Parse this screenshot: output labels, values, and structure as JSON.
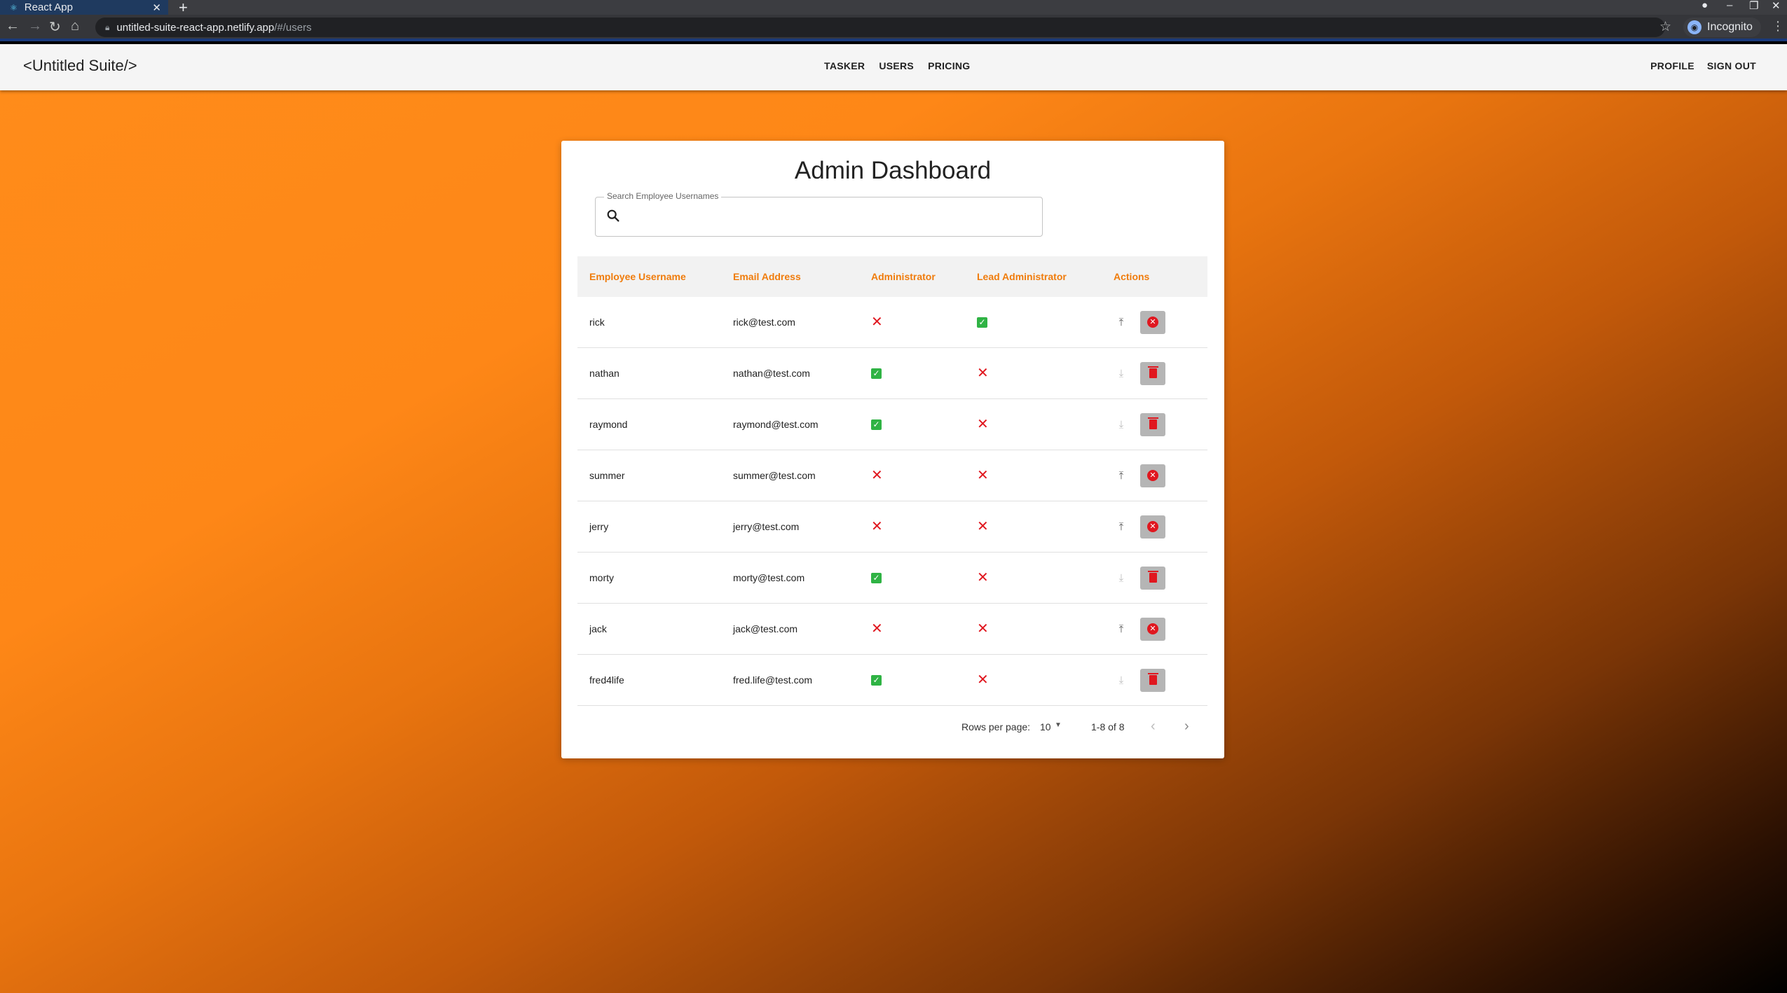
{
  "browser": {
    "tab_title": "React App",
    "tab_close": "✕",
    "new_tab": "+",
    "url_host": "untitled-suite-react-app.netlify.app",
    "url_path": "/#/users",
    "profile_label": "Incognito"
  },
  "appbar": {
    "brand": "<Untitled Suite/>",
    "nav": [
      "TASKER",
      "USERS",
      "PRICING"
    ],
    "right": [
      "PROFILE",
      "SIGN OUT"
    ]
  },
  "dashboard": {
    "title": "Admin Dashboard",
    "search_label": "Search Employee Usernames",
    "search_value": ""
  },
  "table": {
    "headers": [
      "Employee Username",
      "Email Address",
      "Administrator",
      "Lead Administrator",
      "Actions"
    ],
    "rows": [
      {
        "username": "rick",
        "email": "rick@test.com",
        "admin": false,
        "lead": true
      },
      {
        "username": "nathan",
        "email": "nathan@test.com",
        "admin": true,
        "lead": false
      },
      {
        "username": "raymond",
        "email": "raymond@test.com",
        "admin": true,
        "lead": false
      },
      {
        "username": "summer",
        "email": "summer@test.com",
        "admin": false,
        "lead": false
      },
      {
        "username": "jerry",
        "email": "jerry@test.com",
        "admin": false,
        "lead": false
      },
      {
        "username": "morty",
        "email": "morty@test.com",
        "admin": true,
        "lead": false
      },
      {
        "username": "jack",
        "email": "jack@test.com",
        "admin": false,
        "lead": false
      },
      {
        "username": "fred4life",
        "email": "fred.life@test.com",
        "admin": true,
        "lead": false
      }
    ]
  },
  "pagination": {
    "rows_per_page_label": "Rows per page:",
    "rows_per_page": "10",
    "range": "1-8 of 8"
  },
  "colors": {
    "accent": "#f07c0c",
    "error": "#e0171f",
    "success": "#2fb344"
  }
}
